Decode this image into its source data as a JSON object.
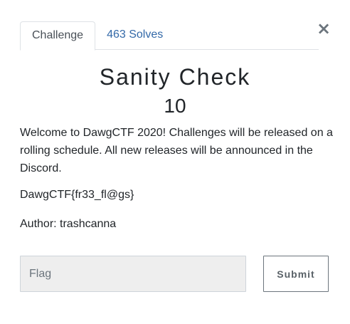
{
  "modal": {
    "close_glyph": "×",
    "tabs": [
      {
        "label": "Challenge",
        "active": true
      },
      {
        "label": "463 Solves",
        "active": false
      }
    ],
    "challenge": {
      "name": "Sanity Check",
      "value": "10",
      "description": "Welcome to DawgCTF 2020! Challenges will be released on a rolling schedule. All new releases will be announced in the Discord.",
      "flag_text": "DawgCTF{fr33_fl@gs}",
      "author": "Author: trashcanna"
    },
    "form": {
      "flag_placeholder": "Flag",
      "flag_value": "",
      "submit_label": "Submit"
    }
  },
  "colors": {
    "link": "#3369a8",
    "input_bg": "#eeeeee"
  }
}
